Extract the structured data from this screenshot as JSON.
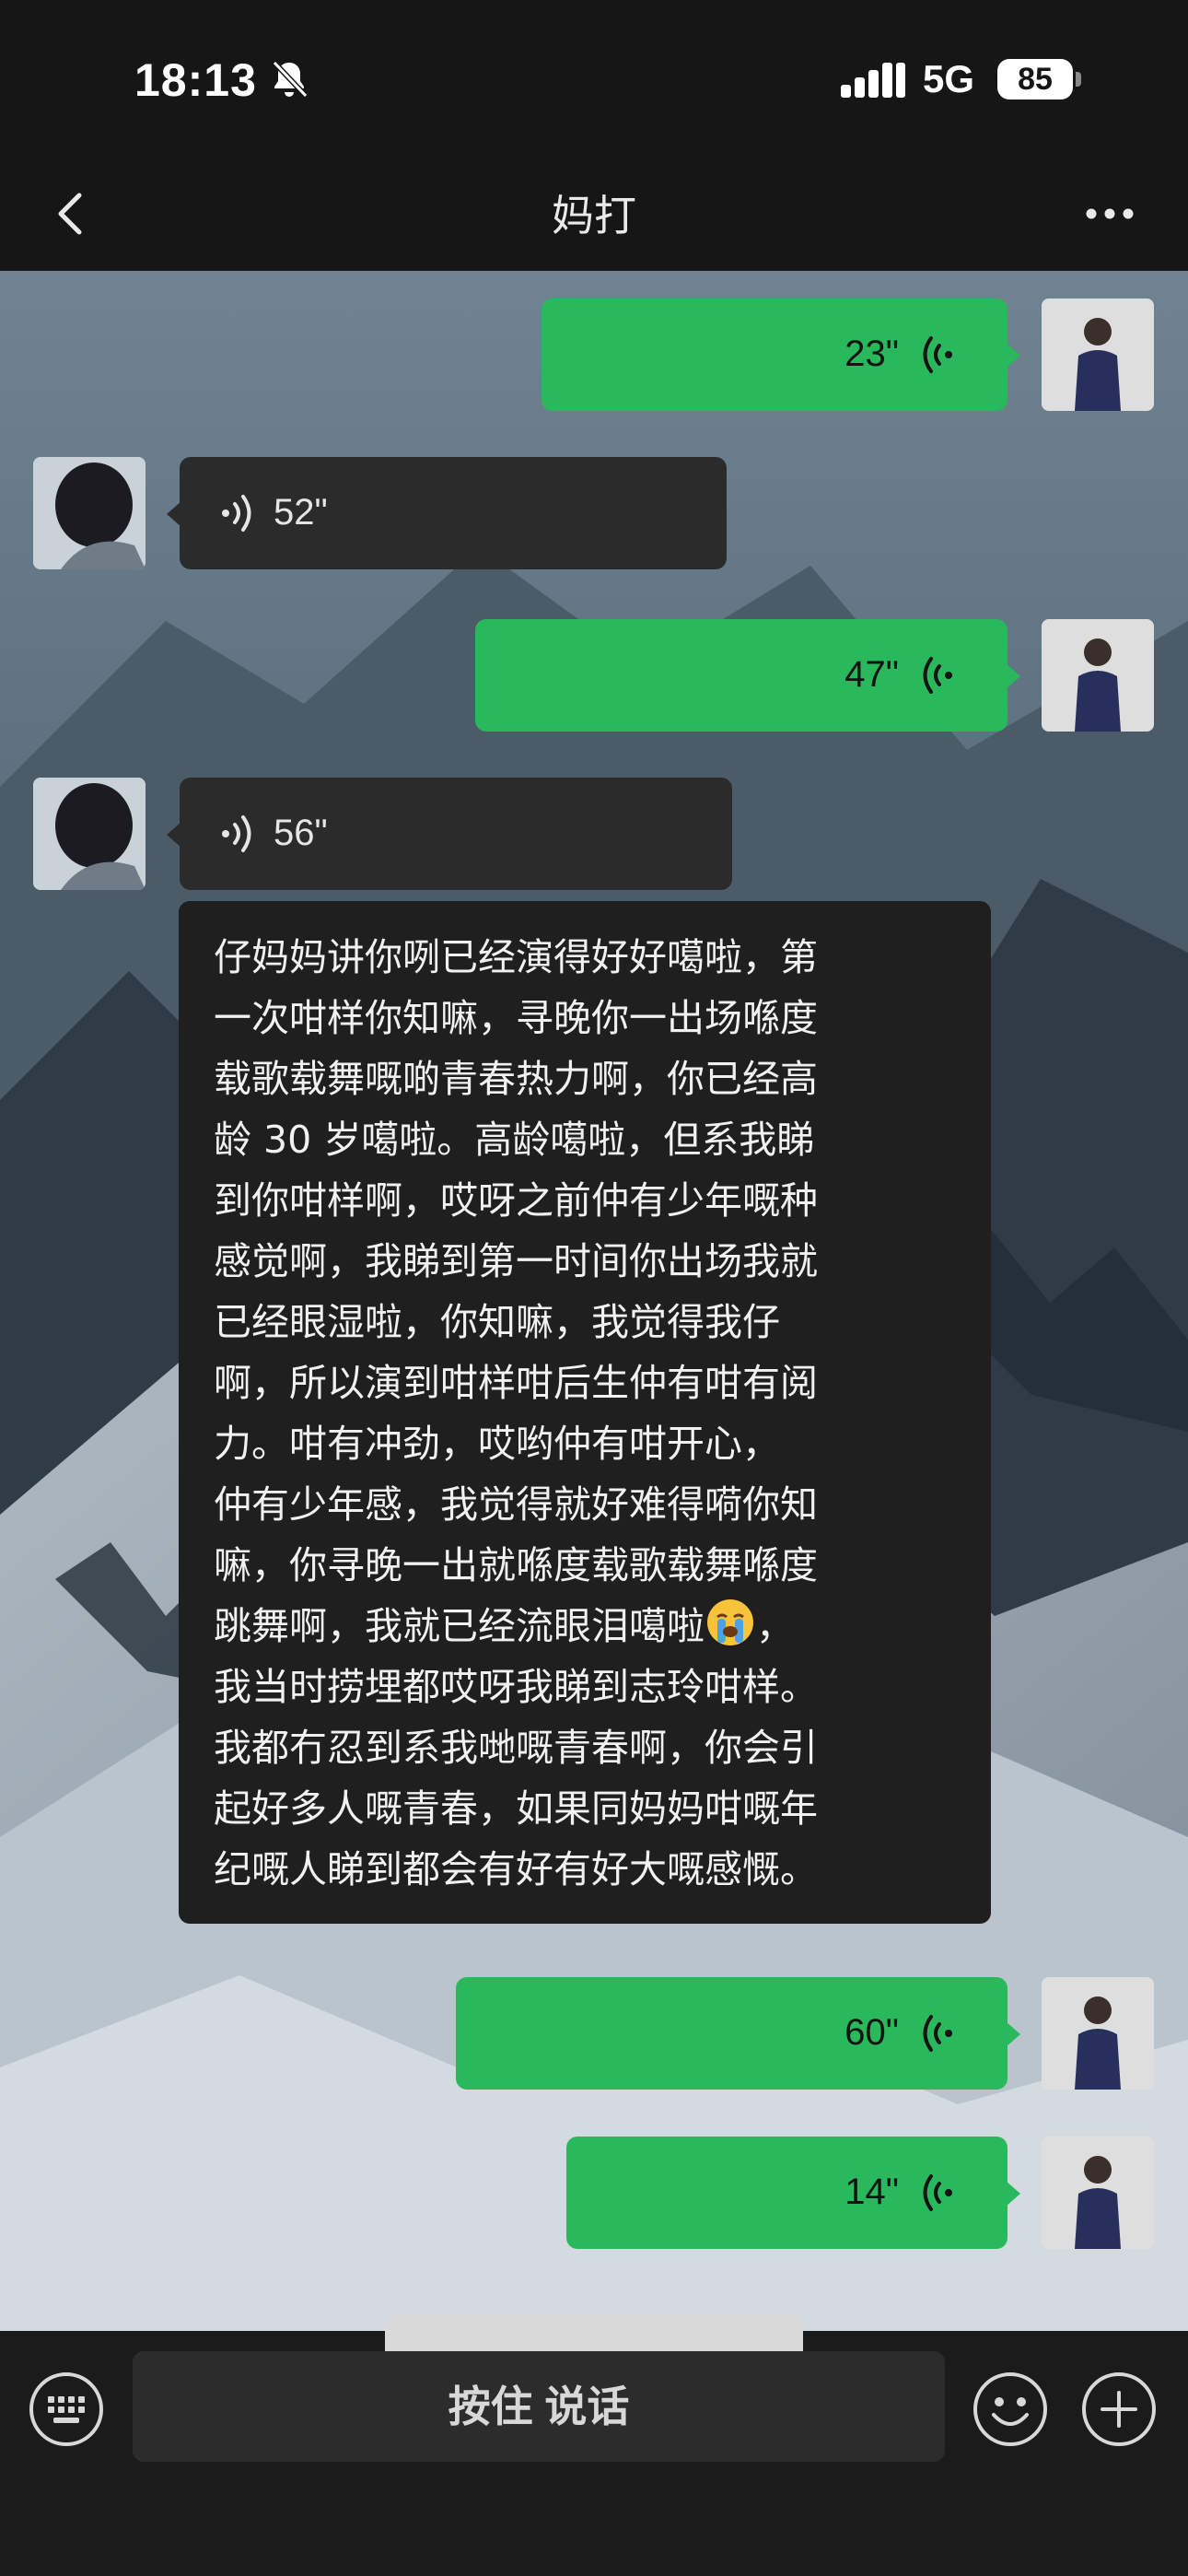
{
  "status_bar": {
    "time": "18:13",
    "network": "5G",
    "battery": "85"
  },
  "nav": {
    "title": "妈打"
  },
  "messages": [
    {
      "side": "me",
      "type": "voice",
      "duration": "23\""
    },
    {
      "side": "her",
      "type": "voice",
      "duration": "52\""
    },
    {
      "side": "me",
      "type": "voice",
      "duration": "47\""
    },
    {
      "side": "her",
      "type": "voice",
      "duration": "56\""
    },
    {
      "side": "me",
      "type": "voice",
      "duration": "60\""
    },
    {
      "side": "me",
      "type": "voice",
      "duration": "14\""
    }
  ],
  "transcript": {
    "lines": [
      "仔妈妈讲你咧已经演得好好噶啦，第",
      "一次咁样你知嘛，寻晚你一出场喺度",
      "载歌载舞嘅啲青春热力啊，你已经高",
      "龄 30 岁噶啦。高龄噶啦，但系我睇",
      "到你咁样啊，哎呀之前仲有少年嘅种",
      "感觉啊，我睇到第一时间你出场我就",
      "已经眼湿啦，你知嘛，我觉得我仔",
      "啊，所以演到咁样咁后生仲有咁有阅",
      "力。咁有冲劲，哎哟仲有咁开心，",
      "仲有少年感，我觉得就好难得嗬你知",
      "嘛，你寻晚一出就喺度载歌载舞喺度",
      "跳舞啊，我就已经流眼泪噶啦",
      "我当时捞埋都哎呀我睇到志玲咁样。",
      "我都冇忍到系我哋嘅青春啊，你会引",
      "起好多人嘅青春，如果同妈妈咁嘅年",
      "纪嘅人睇到都会有好有好大嘅感慨。"
    ],
    "line12_suffix": "，"
  },
  "input": {
    "hold_to_talk": "按住 说话"
  },
  "colors": {
    "green_bubble": "#2ab85c",
    "dark_bubble": "#2b2b2b",
    "transcript_bg": "#1f1f1f"
  }
}
